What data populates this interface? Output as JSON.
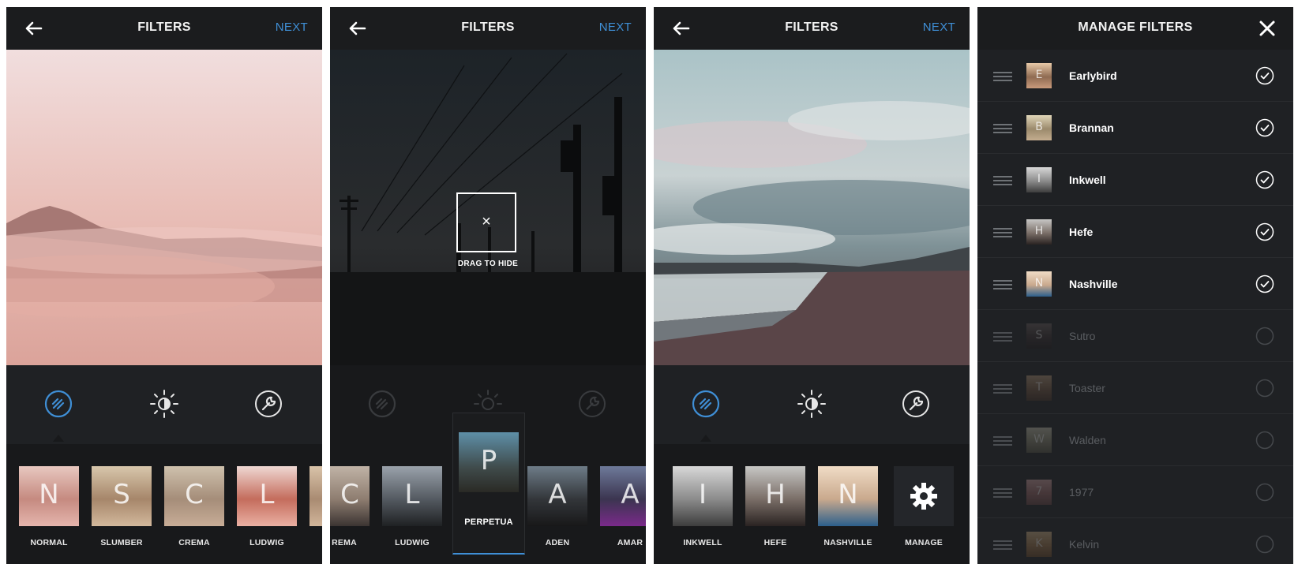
{
  "colors": {
    "accent": "#3f8fd6",
    "background": "#1e2022",
    "strip": "#18191b"
  },
  "screen1": {
    "title": "FILTERS",
    "next_label": "NEXT",
    "filters": [
      {
        "letter": "N",
        "name": "NORMAL"
      },
      {
        "letter": "S",
        "name": "SLUMBER"
      },
      {
        "letter": "C",
        "name": "CREMA"
      },
      {
        "letter": "L",
        "name": "LUDWIG"
      }
    ]
  },
  "screen2": {
    "title": "FILTERS",
    "next_label": "NEXT",
    "hide_label": "DRAG TO HIDE",
    "hide_icon": "×",
    "selected": {
      "letter": "P",
      "name": "PERPETUA"
    },
    "filters": [
      {
        "letter": "C",
        "name": "REMA"
      },
      {
        "letter": "L",
        "name": "LUDWIG"
      },
      {
        "letter": "A",
        "name": "ADEN"
      },
      {
        "letter": "A",
        "name": "AMAR"
      }
    ]
  },
  "screen3": {
    "title": "FILTERS",
    "next_label": "NEXT",
    "filters": [
      {
        "letter": "I",
        "name": "INKWELL"
      },
      {
        "letter": "H",
        "name": "HEFE"
      },
      {
        "letter": "N",
        "name": "NASHVILLE"
      }
    ],
    "manage_label": "MANAGE"
  },
  "screen4": {
    "title": "MANAGE FILTERS",
    "items": [
      {
        "letter": "E",
        "name": "Earlybird",
        "enabled": true
      },
      {
        "letter": "B",
        "name": "Brannan",
        "enabled": true
      },
      {
        "letter": "I",
        "name": "Inkwell",
        "enabled": true
      },
      {
        "letter": "H",
        "name": "Hefe",
        "enabled": true
      },
      {
        "letter": "N",
        "name": "Nashville",
        "enabled": true
      },
      {
        "letter": "S",
        "name": "Sutro",
        "enabled": false
      },
      {
        "letter": "T",
        "name": "Toaster",
        "enabled": false
      },
      {
        "letter": "W",
        "name": "Walden",
        "enabled": false
      },
      {
        "letter": "7",
        "name": "1977",
        "enabled": false
      },
      {
        "letter": "K",
        "name": "Kelvin",
        "enabled": false
      }
    ]
  }
}
